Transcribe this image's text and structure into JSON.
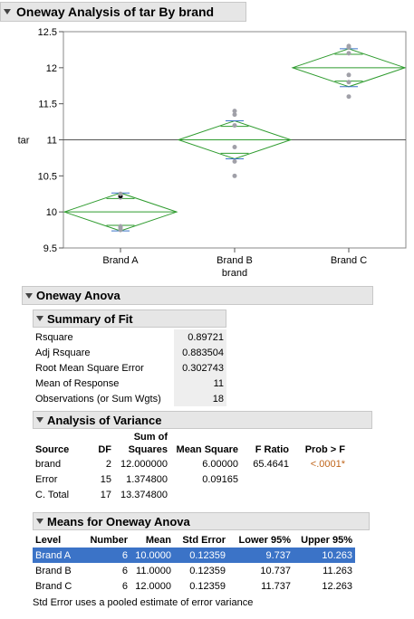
{
  "main": {
    "title": "Oneway Analysis of tar By brand"
  },
  "chart_data": {
    "type": "scatter",
    "ylabel": "tar",
    "xlabel": "brand",
    "ylim": [
      9.5,
      12.5
    ],
    "yticks": [
      9.5,
      10,
      10.5,
      11,
      11.5,
      12,
      12.5
    ],
    "ytick_labels": [
      "9.5",
      "10",
      "10.5",
      "11",
      "11.5",
      "12",
      "12.5"
    ],
    "categories": [
      "Brand A",
      "Brand B",
      "Brand C"
    ],
    "grand_mean": 11,
    "groups": [
      {
        "name": "Brand A",
        "mean": 10.0,
        "lower95": 9.737,
        "upper95": 10.263,
        "points": [
          9.75,
          9.78,
          9.8,
          10.2,
          10.22,
          10.25
        ],
        "selected_point": 10.22
      },
      {
        "name": "Brand B",
        "mean": 11.0,
        "lower95": 10.737,
        "upper95": 11.263,
        "points": [
          10.5,
          10.7,
          10.9,
          11.2,
          11.35,
          11.4
        ],
        "selected_point": null
      },
      {
        "name": "Brand C",
        "mean": 12.0,
        "lower95": 11.737,
        "upper95": 12.263,
        "points": [
          11.6,
          11.8,
          11.9,
          12.2,
          12.28,
          12.3
        ],
        "selected_point": null
      }
    ],
    "colors": {
      "diamond": "#2e9b2e",
      "points": "#a0a0a8",
      "selected_point": "#000000",
      "mean_line": "#555555"
    }
  },
  "anova": {
    "title": "Oneway Anova",
    "summary_of_fit": {
      "title": "Summary of Fit",
      "rows": [
        {
          "label": "Rsquare",
          "value": "0.89721"
        },
        {
          "label": "Adj Rsquare",
          "value": "0.883504"
        },
        {
          "label": "Root Mean Square Error",
          "value": "0.302743"
        },
        {
          "label": "Mean of Response",
          "value": "11"
        },
        {
          "label": "Observations (or Sum Wgts)",
          "value": "18"
        }
      ]
    },
    "analysis_of_variance": {
      "title": "Analysis of Variance",
      "headers": {
        "source": "Source",
        "df": "DF",
        "ss_top": "Sum of",
        "ss_bottom": "Squares",
        "ms": "Mean Square",
        "f": "F Ratio",
        "p": "Prob > F"
      },
      "rows": [
        {
          "source": "brand",
          "df": "2",
          "ss": "12.000000",
          "ms": "6.00000",
          "f": "65.4641",
          "p": "<.0001*"
        },
        {
          "source": "Error",
          "df": "15",
          "ss": "1.374800",
          "ms": "0.09165",
          "f": "",
          "p": ""
        },
        {
          "source": "C. Total",
          "df": "17",
          "ss": "13.374800",
          "ms": "",
          "f": "",
          "p": ""
        }
      ]
    },
    "means": {
      "title": "Means for Oneway Anova",
      "headers": [
        "Level",
        "Number",
        "Mean",
        "Std Error",
        "Lower 95%",
        "Upper 95%"
      ],
      "rows": [
        {
          "level": "Brand A",
          "number": "6",
          "mean": "10.0000",
          "se": "0.12359",
          "lower": "9.737",
          "upper": "10.263",
          "selected": true
        },
        {
          "level": "Brand B",
          "number": "6",
          "mean": "11.0000",
          "se": "0.12359",
          "lower": "10.737",
          "upper": "11.263",
          "selected": false
        },
        {
          "level": "Brand C",
          "number": "6",
          "mean": "12.0000",
          "se": "0.12359",
          "lower": "11.737",
          "upper": "12.263",
          "selected": false
        }
      ],
      "note": "Std Error uses a pooled estimate of error variance"
    }
  }
}
